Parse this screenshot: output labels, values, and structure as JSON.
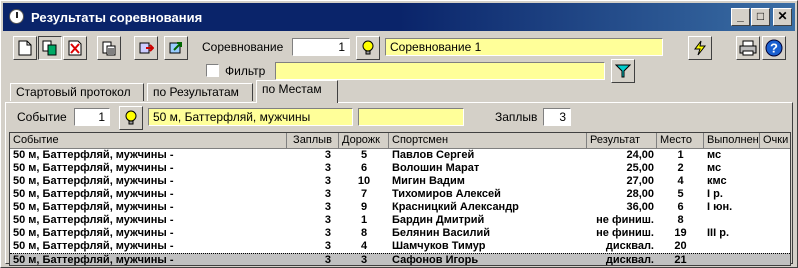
{
  "window": {
    "title": "Результаты соревнования"
  },
  "toolbar": {
    "competition_label": "Соревнование",
    "competition_number": "1",
    "competition_name": "Соревнование 1",
    "filter_label": "Фильтр",
    "filter_value": ""
  },
  "tabs": [
    {
      "label": "Стартовый протокол"
    },
    {
      "label": "по Результатам"
    },
    {
      "label": "по Местам"
    }
  ],
  "event_bar": {
    "event_label": "Событие",
    "event_number": "1",
    "event_name": "50 м, Баттерфляй, мужчины",
    "extra_value": "",
    "heat_label": "Заплыв",
    "heat_value": "3"
  },
  "table": {
    "columns": [
      "Событие",
      "Заплыв",
      "Дорожк",
      "Спортсмен",
      "Результат",
      "Место",
      "Выполнен",
      "Очки"
    ],
    "rows": [
      {
        "event": "50 м, Баттерфляй, мужчины -",
        "heat": "3",
        "lane": "5",
        "athlete": "Павлов Сергей",
        "result": "24,00",
        "place": "1",
        "rank": "мс",
        "points": ""
      },
      {
        "event": "50 м, Баттерфляй, мужчины -",
        "heat": "3",
        "lane": "6",
        "athlete": "Волошин Марат",
        "result": "25,00",
        "place": "2",
        "rank": "мс",
        "points": ""
      },
      {
        "event": "50 м, Баттерфляй, мужчины -",
        "heat": "3",
        "lane": "10",
        "athlete": "Мигин Вадим",
        "result": "27,00",
        "place": "4",
        "rank": "кмс",
        "points": ""
      },
      {
        "event": "50 м, Баттерфляй, мужчины -",
        "heat": "3",
        "lane": "7",
        "athlete": "Тихомиров Алексей",
        "result": "28,00",
        "place": "5",
        "rank": "I р.",
        "points": ""
      },
      {
        "event": "50 м, Баттерфляй, мужчины -",
        "heat": "3",
        "lane": "9",
        "athlete": "Красницкий Александр",
        "result": "36,00",
        "place": "6",
        "rank": "I юн.",
        "points": ""
      },
      {
        "event": "50 м, Баттерфляй, мужчины -",
        "heat": "3",
        "lane": "1",
        "athlete": "Бардин Дмитрий",
        "result": "не финиш.",
        "place": "8",
        "rank": "",
        "points": ""
      },
      {
        "event": "50 м, Баттерфляй, мужчины -",
        "heat": "3",
        "lane": "8",
        "athlete": "Белянин Василий",
        "result": "не финиш.",
        "place": "19",
        "rank": "III р.",
        "points": ""
      },
      {
        "event": "50 м, Баттерфляй, мужчины -",
        "heat": "3",
        "lane": "4",
        "athlete": "Шамчуков Тимур",
        "result": "дисквал.",
        "place": "20",
        "rank": "",
        "points": ""
      },
      {
        "event": "50 м, Баттерфляй, мужчины -",
        "heat": "3",
        "lane": "3",
        "athlete": "Сафонов Игорь",
        "result": "дисквал.",
        "place": "21",
        "rank": "",
        "points": ""
      }
    ]
  }
}
